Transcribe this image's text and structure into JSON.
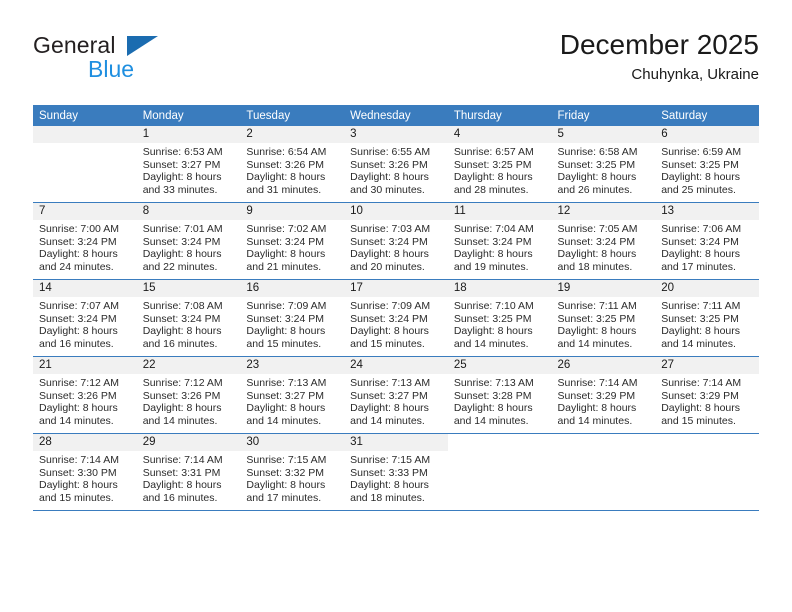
{
  "logo": {
    "word_top": "General",
    "word_bottom": "Blue",
    "triangle_icon": "triangle-icon",
    "colors": {
      "dark": "#231f20",
      "blue": "#1f8fe0",
      "triangle": "#1b6cb0"
    }
  },
  "header": {
    "month_title": "December 2025",
    "location": "Chuhynka, Ukraine"
  },
  "colors": {
    "header_background": "#3a7cbe",
    "header_text": "#ffffff",
    "date_band": "#f1f1f1",
    "cell_background": "#ffffff",
    "grid_line": "#3a7cbe",
    "body_text": "#2b2b2b"
  },
  "weekday_headers": [
    "Sunday",
    "Monday",
    "Tuesday",
    "Wednesday",
    "Thursday",
    "Friday",
    "Saturday"
  ],
  "weeks": [
    {
      "days": [
        {
          "date": "",
          "lines": []
        },
        {
          "date": "1",
          "lines": [
            "Sunrise: 6:53 AM",
            "Sunset: 3:27 PM",
            "Daylight: 8 hours",
            "and 33 minutes."
          ]
        },
        {
          "date": "2",
          "lines": [
            "Sunrise: 6:54 AM",
            "Sunset: 3:26 PM",
            "Daylight: 8 hours",
            "and 31 minutes."
          ]
        },
        {
          "date": "3",
          "lines": [
            "Sunrise: 6:55 AM",
            "Sunset: 3:26 PM",
            "Daylight: 8 hours",
            "and 30 minutes."
          ]
        },
        {
          "date": "4",
          "lines": [
            "Sunrise: 6:57 AM",
            "Sunset: 3:25 PM",
            "Daylight: 8 hours",
            "and 28 minutes."
          ]
        },
        {
          "date": "5",
          "lines": [
            "Sunrise: 6:58 AM",
            "Sunset: 3:25 PM",
            "Daylight: 8 hours",
            "and 26 minutes."
          ]
        },
        {
          "date": "6",
          "lines": [
            "Sunrise: 6:59 AM",
            "Sunset: 3:25 PM",
            "Daylight: 8 hours",
            "and 25 minutes."
          ]
        }
      ]
    },
    {
      "days": [
        {
          "date": "7",
          "lines": [
            "Sunrise: 7:00 AM",
            "Sunset: 3:24 PM",
            "Daylight: 8 hours",
            "and 24 minutes."
          ]
        },
        {
          "date": "8",
          "lines": [
            "Sunrise: 7:01 AM",
            "Sunset: 3:24 PM",
            "Daylight: 8 hours",
            "and 22 minutes."
          ]
        },
        {
          "date": "9",
          "lines": [
            "Sunrise: 7:02 AM",
            "Sunset: 3:24 PM",
            "Daylight: 8 hours",
            "and 21 minutes."
          ]
        },
        {
          "date": "10",
          "lines": [
            "Sunrise: 7:03 AM",
            "Sunset: 3:24 PM",
            "Daylight: 8 hours",
            "and 20 minutes."
          ]
        },
        {
          "date": "11",
          "lines": [
            "Sunrise: 7:04 AM",
            "Sunset: 3:24 PM",
            "Daylight: 8 hours",
            "and 19 minutes."
          ]
        },
        {
          "date": "12",
          "lines": [
            "Sunrise: 7:05 AM",
            "Sunset: 3:24 PM",
            "Daylight: 8 hours",
            "and 18 minutes."
          ]
        },
        {
          "date": "13",
          "lines": [
            "Sunrise: 7:06 AM",
            "Sunset: 3:24 PM",
            "Daylight: 8 hours",
            "and 17 minutes."
          ]
        }
      ]
    },
    {
      "days": [
        {
          "date": "14",
          "lines": [
            "Sunrise: 7:07 AM",
            "Sunset: 3:24 PM",
            "Daylight: 8 hours",
            "and 16 minutes."
          ]
        },
        {
          "date": "15",
          "lines": [
            "Sunrise: 7:08 AM",
            "Sunset: 3:24 PM",
            "Daylight: 8 hours",
            "and 16 minutes."
          ]
        },
        {
          "date": "16",
          "lines": [
            "Sunrise: 7:09 AM",
            "Sunset: 3:24 PM",
            "Daylight: 8 hours",
            "and 15 minutes."
          ]
        },
        {
          "date": "17",
          "lines": [
            "Sunrise: 7:09 AM",
            "Sunset: 3:24 PM",
            "Daylight: 8 hours",
            "and 15 minutes."
          ]
        },
        {
          "date": "18",
          "lines": [
            "Sunrise: 7:10 AM",
            "Sunset: 3:25 PM",
            "Daylight: 8 hours",
            "and 14 minutes."
          ]
        },
        {
          "date": "19",
          "lines": [
            "Sunrise: 7:11 AM",
            "Sunset: 3:25 PM",
            "Daylight: 8 hours",
            "and 14 minutes."
          ]
        },
        {
          "date": "20",
          "lines": [
            "Sunrise: 7:11 AM",
            "Sunset: 3:25 PM",
            "Daylight: 8 hours",
            "and 14 minutes."
          ]
        }
      ]
    },
    {
      "days": [
        {
          "date": "21",
          "lines": [
            "Sunrise: 7:12 AM",
            "Sunset: 3:26 PM",
            "Daylight: 8 hours",
            "and 14 minutes."
          ]
        },
        {
          "date": "22",
          "lines": [
            "Sunrise: 7:12 AM",
            "Sunset: 3:26 PM",
            "Daylight: 8 hours",
            "and 14 minutes."
          ]
        },
        {
          "date": "23",
          "lines": [
            "Sunrise: 7:13 AM",
            "Sunset: 3:27 PM",
            "Daylight: 8 hours",
            "and 14 minutes."
          ]
        },
        {
          "date": "24",
          "lines": [
            "Sunrise: 7:13 AM",
            "Sunset: 3:27 PM",
            "Daylight: 8 hours",
            "and 14 minutes."
          ]
        },
        {
          "date": "25",
          "lines": [
            "Sunrise: 7:13 AM",
            "Sunset: 3:28 PM",
            "Daylight: 8 hours",
            "and 14 minutes."
          ]
        },
        {
          "date": "26",
          "lines": [
            "Sunrise: 7:14 AM",
            "Sunset: 3:29 PM",
            "Daylight: 8 hours",
            "and 14 minutes."
          ]
        },
        {
          "date": "27",
          "lines": [
            "Sunrise: 7:14 AM",
            "Sunset: 3:29 PM",
            "Daylight: 8 hours",
            "and 15 minutes."
          ]
        }
      ]
    },
    {
      "days": [
        {
          "date": "28",
          "lines": [
            "Sunrise: 7:14 AM",
            "Sunset: 3:30 PM",
            "Daylight: 8 hours",
            "and 15 minutes."
          ]
        },
        {
          "date": "29",
          "lines": [
            "Sunrise: 7:14 AM",
            "Sunset: 3:31 PM",
            "Daylight: 8 hours",
            "and 16 minutes."
          ]
        },
        {
          "date": "30",
          "lines": [
            "Sunrise: 7:15 AM",
            "Sunset: 3:32 PM",
            "Daylight: 8 hours",
            "and 17 minutes."
          ]
        },
        {
          "date": "31",
          "lines": [
            "Sunrise: 7:15 AM",
            "Sunset: 3:33 PM",
            "Daylight: 8 hours",
            "and 18 minutes."
          ]
        },
        {
          "date": "",
          "lines": [],
          "blank": true
        },
        {
          "date": "",
          "lines": [],
          "blank": true
        },
        {
          "date": "",
          "lines": [],
          "blank": true
        }
      ]
    }
  ]
}
